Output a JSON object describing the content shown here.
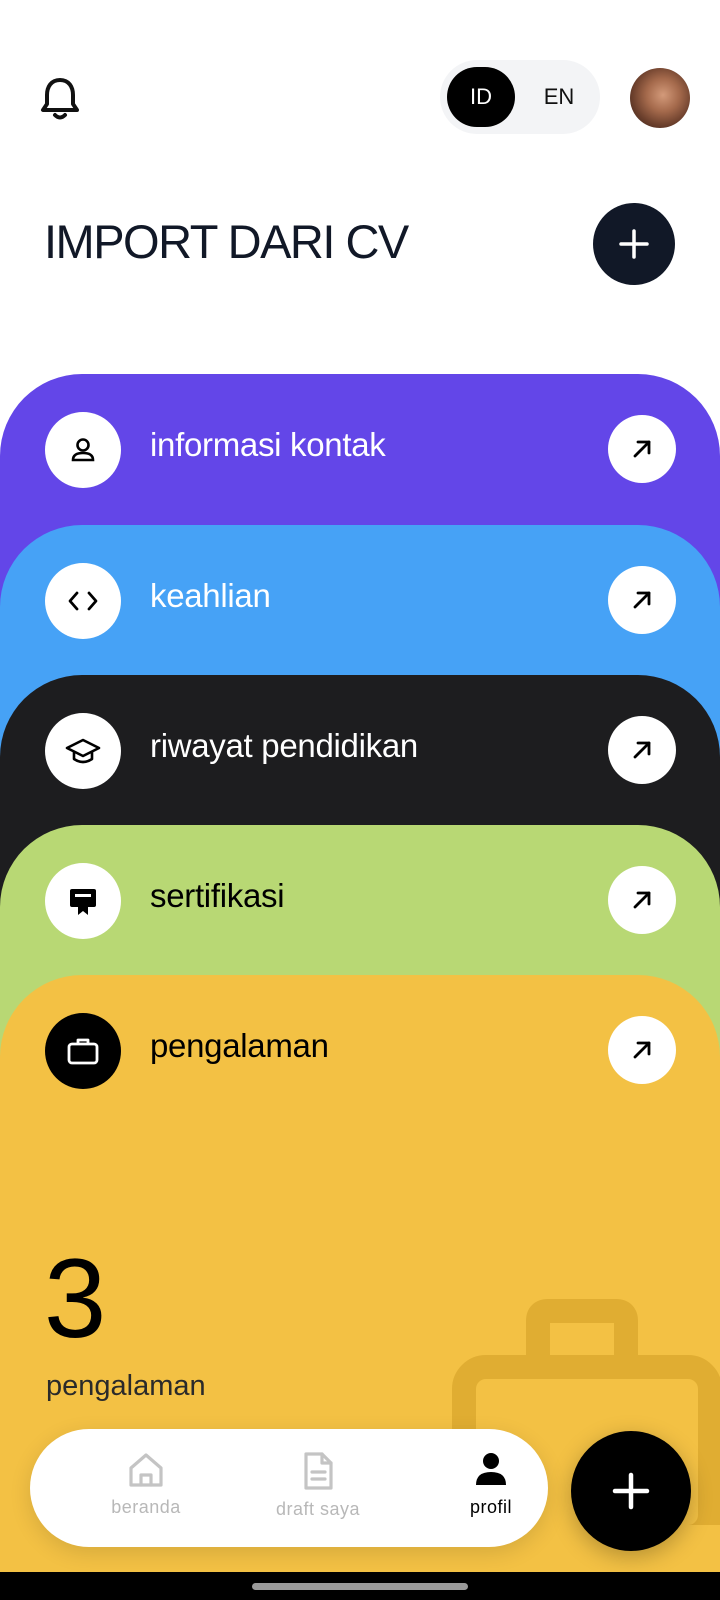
{
  "header": {
    "notification_icon": "bell-icon",
    "language": {
      "options": [
        "ID",
        "EN"
      ],
      "selected": "ID"
    },
    "avatar": "user-avatar"
  },
  "page": {
    "title": "IMPORT DARI CV",
    "add_icon": "plus-icon"
  },
  "sections": [
    {
      "label": "informasi kontak",
      "icon": "person-icon",
      "color": "#6346e8"
    },
    {
      "label": "keahlian",
      "icon": "code-icon",
      "color": "#46a2f6"
    },
    {
      "label": "riwayat pendidikan",
      "icon": "graduation-cap-icon",
      "color": "#1d1d1f"
    },
    {
      "label": "sertifikasi",
      "icon": "certificate-icon",
      "color": "#b8d874"
    },
    {
      "label": "pengalaman",
      "icon": "briefcase-icon",
      "color": "#f3c144"
    }
  ],
  "active_section": {
    "count": "3",
    "count_label": "pengalaman"
  },
  "bottom_nav": {
    "items": [
      {
        "label": "beranda",
        "icon": "home-icon"
      },
      {
        "label": "draft saya",
        "icon": "document-icon"
      },
      {
        "label": "profil",
        "icon": "person-icon"
      }
    ],
    "active": "profil"
  },
  "fab": {
    "icon": "plus-icon"
  }
}
